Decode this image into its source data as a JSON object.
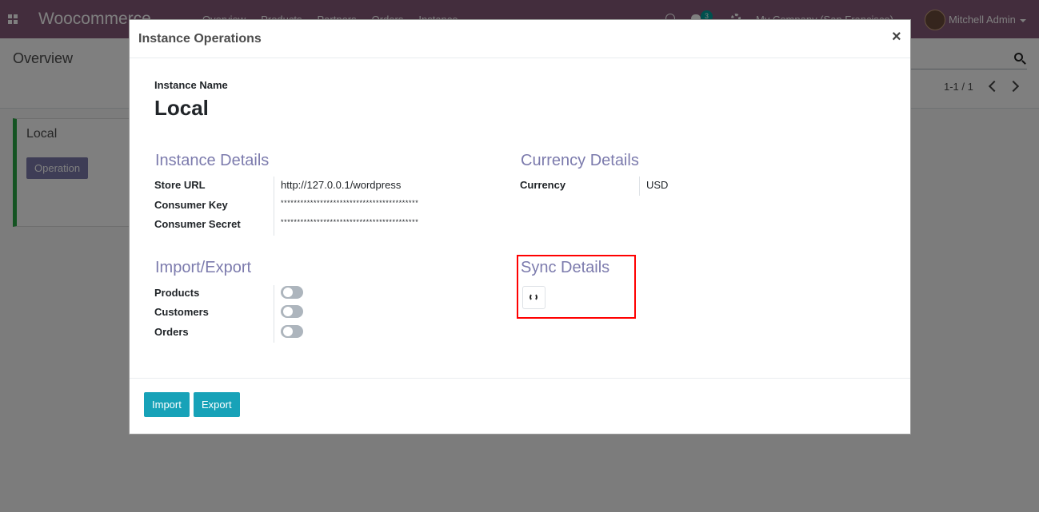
{
  "navbar": {
    "brand": "Woocommerce",
    "menu": [
      "Overview",
      "Products",
      "Partners",
      "Orders",
      "Instance"
    ],
    "messages_badge": "3",
    "company": "My Company (San Francisco)",
    "user": "Mitchell Admin"
  },
  "control_panel": {
    "breadcrumb": "Overview",
    "pager": "1-1 / 1"
  },
  "kanban": {
    "card_title": "Local",
    "card_button": "Operation"
  },
  "modal": {
    "title": "Instance Operations",
    "close": "×",
    "instance_name_label": "Instance Name",
    "instance_name": "Local",
    "instance_details": {
      "title": "Instance Details",
      "fields": [
        {
          "label": "Store URL",
          "value": "http://127.0.0.1/wordpress"
        },
        {
          "label": "Consumer Key",
          "value": "******************************************"
        },
        {
          "label": "Consumer Secret",
          "value": "******************************************"
        }
      ]
    },
    "currency_details": {
      "title": "Currency Details",
      "label": "Currency",
      "value": "USD"
    },
    "import_export": {
      "title": "Import/Export",
      "items": [
        {
          "label": "Products",
          "enabled": false
        },
        {
          "label": "Customers",
          "enabled": false
        },
        {
          "label": "Orders",
          "enabled": false
        }
      ]
    },
    "sync_details": {
      "title": "Sync Details",
      "button_icon": "refresh-icon"
    },
    "footer": {
      "import_label": "Import",
      "export_label": "Export"
    }
  },
  "colors": {
    "navbar": "#875a7b",
    "group_title": "#7c7bad",
    "primary_button": "#17a2b8",
    "highlight": "#ff0000",
    "card_border": "#28a745"
  }
}
